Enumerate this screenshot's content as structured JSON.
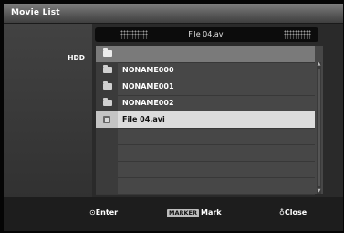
{
  "window": {
    "title": "Movie List"
  },
  "sidebar": {
    "device_label": "HDD"
  },
  "preview": {
    "filename": "File 04.avi"
  },
  "list": {
    "rows": [
      {
        "label": "NONAME000",
        "icon": "folder-icon"
      },
      {
        "label": "NONAME001",
        "icon": "folder-icon"
      },
      {
        "label": "NONAME002",
        "icon": "folder-icon"
      },
      {
        "label": "File 04.avi",
        "icon": "movie-file-icon",
        "selected": true
      }
    ]
  },
  "footer": {
    "enter_symbol": "⊙",
    "enter_label": "Enter",
    "marker_badge": "MARKER",
    "marker_label": "Mark",
    "close_symbol": "♁",
    "close_label": "Close"
  }
}
